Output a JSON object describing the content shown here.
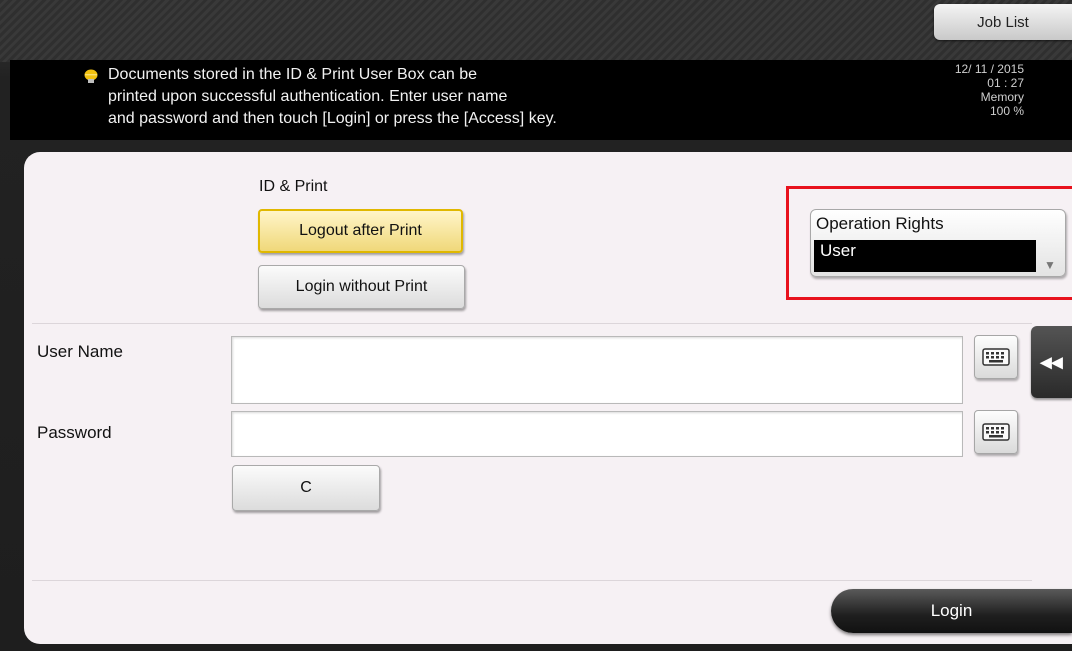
{
  "header": {
    "job_list_label": "Job List",
    "message_lines": [
      "Documents stored in the ID & Print User Box can be",
      "printed upon successful authentication. Enter user name",
      "and password and then touch [Login] or press the [Access] key."
    ],
    "date": "12/ 11 / 2015",
    "time": "01 : 27",
    "memory_label": "Memory",
    "memory_value": "100 %"
  },
  "id_print": {
    "section_label": "ID & Print",
    "logout_after_print_label": "Logout after Print",
    "login_without_print_label": "Login without Print",
    "selected": "Logout after Print"
  },
  "operation_rights": {
    "label": "Operation Rights",
    "value": "User"
  },
  "form": {
    "user_name_label": "User Name",
    "user_name_value": "",
    "password_label": "Password",
    "password_value": "",
    "clear_label": "C"
  },
  "footer": {
    "login_label": "Login",
    "side_tab_glyph": "◂◂"
  },
  "colors": {
    "highlight": "#e8121d",
    "selected_button": "#f0d87a",
    "panel_bg": "#f6f1f4"
  }
}
